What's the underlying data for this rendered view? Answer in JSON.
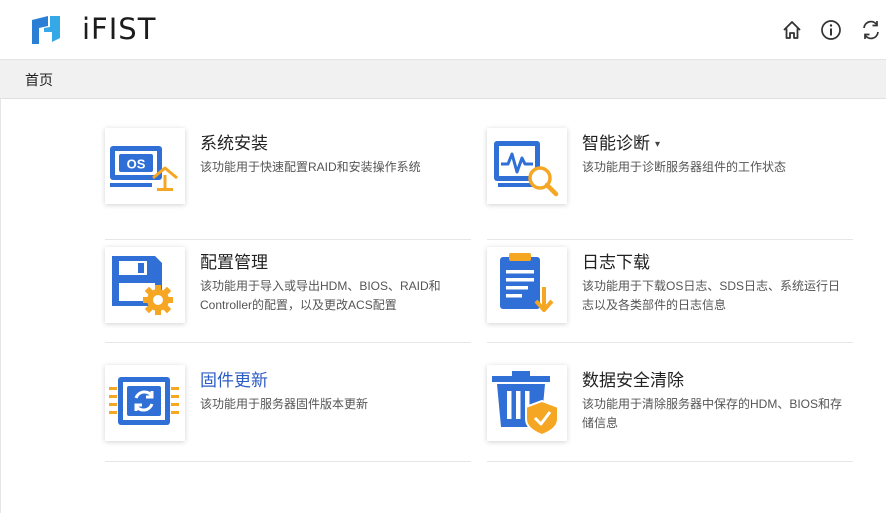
{
  "app": {
    "name": "iFIST"
  },
  "breadcrumb": {
    "home": "首页"
  },
  "cards": [
    {
      "id": "os-install",
      "title": "系统安装",
      "desc": "该功能用于快速配置RAID和安装操作系统",
      "icon": "os-install-icon"
    },
    {
      "id": "diagnosis",
      "title": "智能诊断",
      "desc": "该功能用于诊断服务器组件的工作状态",
      "icon": "diagnosis-icon",
      "caret": "▾"
    },
    {
      "id": "config",
      "title": "配置管理",
      "desc": "该功能用于导入或导出HDM、BIOS、RAID和Controller的配置，以及更改ACS配置",
      "icon": "config-icon"
    },
    {
      "id": "log-download",
      "title": "日志下载",
      "desc": "该功能用于下载OS日志、SDS日志、系统运行日志以及各类部件的日志信息",
      "icon": "log-download-icon"
    },
    {
      "id": "firmware",
      "title": "固件更新",
      "desc": "该功能用于服务器固件版本更新",
      "icon": "firmware-update-icon"
    },
    {
      "id": "secure-erase",
      "title": "数据安全清除",
      "desc": "该功能用于清除服务器中保存的HDM、BIOS和存储信息",
      "icon": "secure-erase-icon"
    }
  ],
  "colors": {
    "accent": "#2f6fd6",
    "orange": "#f5a623",
    "link": "#2c5cc5"
  }
}
